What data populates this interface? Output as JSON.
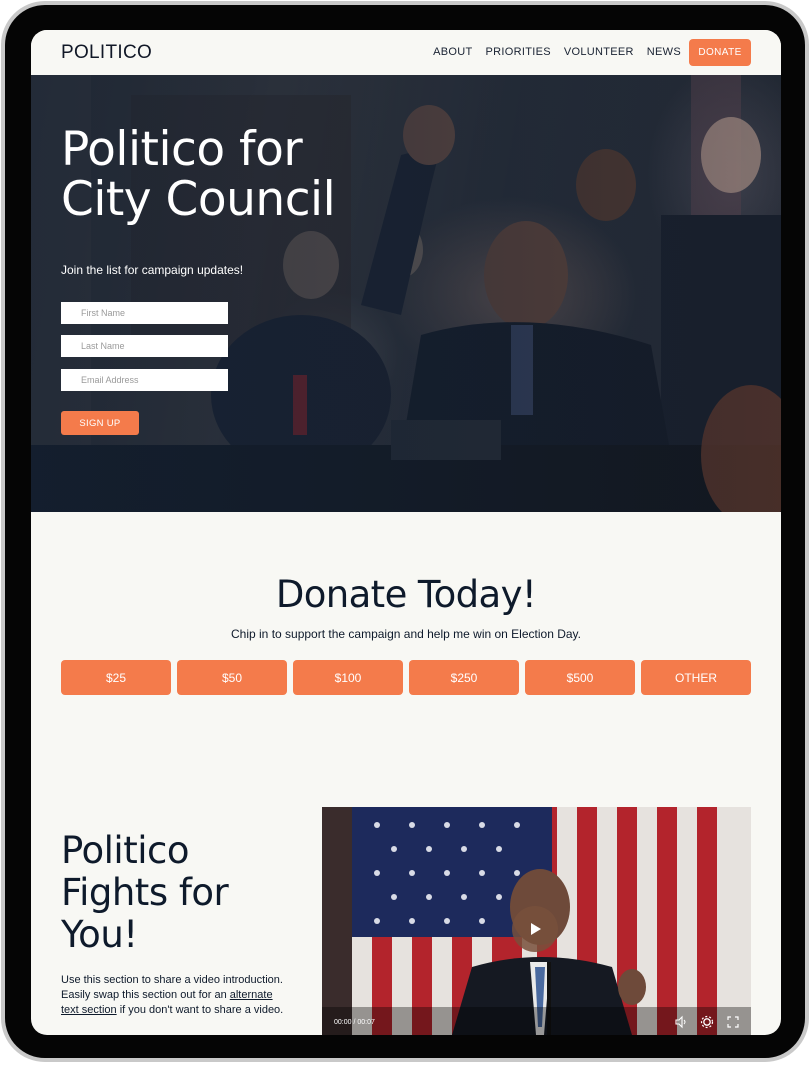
{
  "nav": {
    "logo": "POLITICO",
    "links": [
      "ABOUT",
      "PRIORITIES",
      "VOLUNTEER",
      "NEWS"
    ],
    "donate_label": "DONATE"
  },
  "hero": {
    "title": "Politico for City Council",
    "subtitle": "Join the list for campaign updates!",
    "first_name_placeholder": "First Name",
    "last_name_placeholder": "Last Name",
    "email_placeholder": "Email Address",
    "signup_label": "SIGN UP"
  },
  "donate": {
    "title": "Donate Today!",
    "subtitle": "Chip in to support the campaign and help me win on Election Day.",
    "amounts": [
      "$25",
      "$50",
      "$100",
      "$250",
      "$500",
      "OTHER"
    ]
  },
  "video_section": {
    "title": "Politico Fights for You!",
    "body_prefix": "Use this section to share a video introduction. Easily swap this section out for an ",
    "body_link": "alternate text section",
    "body_suffix": " if you don't want to share a video.",
    "video_time": "00:00 / 00:07"
  },
  "colors": {
    "accent": "#f47b4b",
    "navy": "#0e1a2b",
    "background": "#f8f8f4"
  }
}
